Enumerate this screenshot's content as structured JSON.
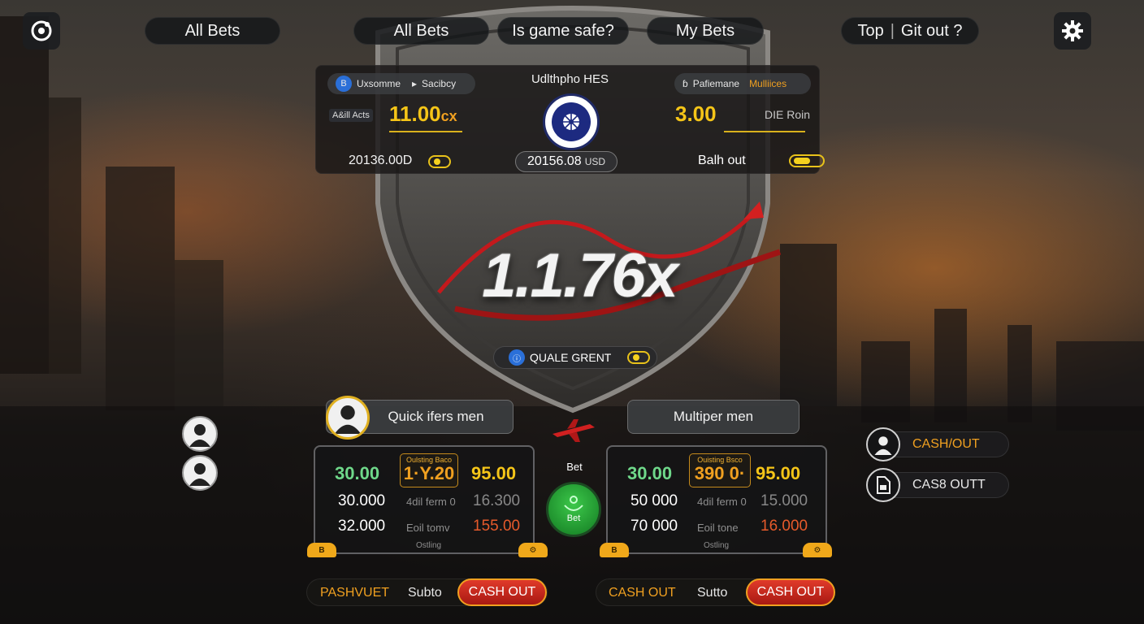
{
  "nav": {
    "all_bets_1": "All Bets",
    "all_bets_2": "All Bets",
    "is_game_safe": "Is game safe?",
    "my_bets": "My Bets",
    "top": "Top",
    "git_out": "Git out ?"
  },
  "panel": {
    "left_pill_a": "Uxsomme",
    "left_pill_b": "Sacibcy",
    "left_label": "A&ill Acts",
    "left_multiplier": "11.00",
    "left_multiplier_suffix": "cx",
    "left_amount": "20136.00D",
    "center_title": "Udlthpho HES",
    "center_amount": "20156.08",
    "center_currency": "USD",
    "right_pill_a": "Pafiemane",
    "right_pill_b": "Mulliices",
    "right_value": "3.00",
    "right_label": "DIE Roin",
    "right_toggle_label": "Balh out"
  },
  "multiplier": "1.1.76x",
  "quick_grent": "QUALE GRENT",
  "left_card": {
    "header": "Quick ifers men",
    "tag_top": "Oulsting Baco",
    "tag_value": "1·Y.20",
    "rows": [
      {
        "a": "30.00",
        "mid": "",
        "b": "95.00"
      },
      {
        "a": "30.000",
        "mid": "4dil ferm 0",
        "b": "16.300"
      },
      {
        "a": "32.000",
        "mid": "Eoil tomv",
        "b": "155.00"
      }
    ],
    "footer": "Ostling"
  },
  "right_card": {
    "header": "Multiper men",
    "tag_top": "Ouisting Bsco",
    "tag_value": "390 0·",
    "rows": [
      {
        "a": "30.00",
        "mid": "",
        "b": "95.00"
      },
      {
        "a": "50 000",
        "mid": "4dil ferm 0",
        "b": "15.000"
      },
      {
        "a": "70 000",
        "mid": "Eoil tone",
        "b": "16.000"
      }
    ],
    "footer": "Ostling"
  },
  "center_bet": {
    "label_top": "Bet",
    "label_button": "Bet"
  },
  "side": {
    "cash_out_top": "CASH/OUT",
    "cash_out_bottom": "CAS8 OUTT"
  },
  "bottom_left": {
    "label": "PASHVUET",
    "auto": "Subto",
    "cash_out": "CASH OUT"
  },
  "bottom_right": {
    "label": "CASH OUT",
    "auto": "Sutto",
    "cash_out": "CASH OUT"
  },
  "colors": {
    "accent_yellow": "#f5c518",
    "accent_orange": "#f0a020",
    "cash_red": "#c82a1c",
    "bet_green": "#2fae3c"
  }
}
